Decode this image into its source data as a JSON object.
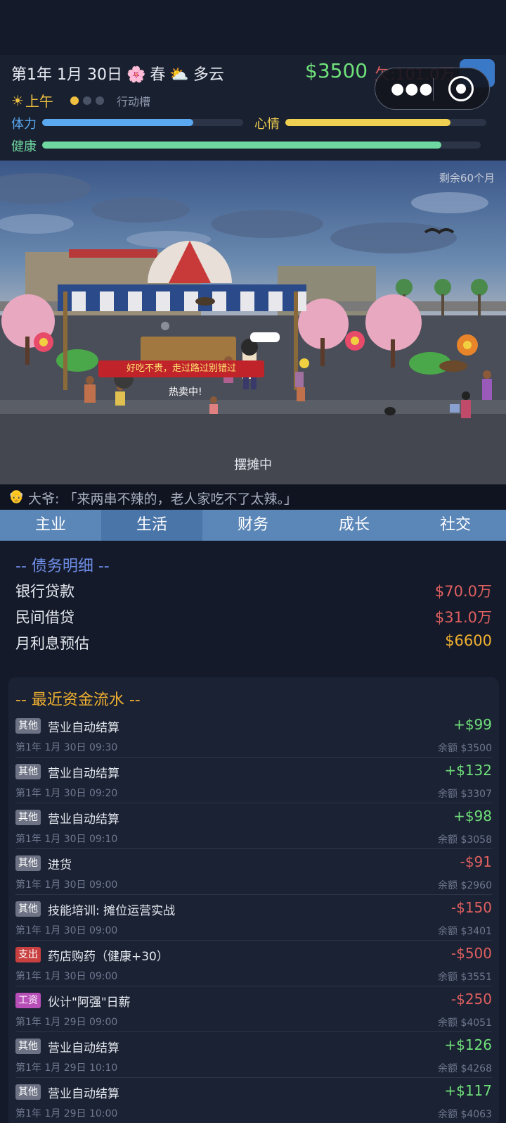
{
  "header": {
    "date": "第1年 1月 30日",
    "season_icon": "🌸",
    "season": "春",
    "weather_icon": "⛅",
    "weather": "多云",
    "money": "$3500",
    "debt": "欠:101.0万",
    "period_icon": "☀",
    "period": "上午",
    "action_label": "行动槽",
    "action_slots": [
      true,
      false,
      false
    ],
    "bars": {
      "stamina": {
        "label": "体力",
        "value": 0.75,
        "color": "#5aa8f0"
      },
      "mood": {
        "label": "心情",
        "value": 0.82,
        "color": "#f0d050"
      },
      "health": {
        "label": "健康",
        "value": 0.91,
        "color": "#6fd7a0"
      }
    }
  },
  "capsule": {
    "more_icon": "more-dots-icon",
    "close_icon": "target-close-icon"
  },
  "scene": {
    "remaining": "剩余60个月",
    "shout": "好吃不贵，走过路过别错过",
    "hot": "热卖中!",
    "status": "摆摊中"
  },
  "message": {
    "icon": "👴",
    "text": "大爷: 「来两串不辣的，老人家吃不了太辣。」"
  },
  "tabs": [
    {
      "label": "主业",
      "active": false
    },
    {
      "label": "生活",
      "active": true
    },
    {
      "label": "财务",
      "active": false
    },
    {
      "label": "成长",
      "active": false
    },
    {
      "label": "社交",
      "active": false
    }
  ],
  "debt_detail": {
    "title": "-- 债务明细 --",
    "rows": [
      {
        "label": "银行贷款",
        "value": "$70.0万",
        "color": "#e06060"
      },
      {
        "label": "民间借贷",
        "value": "$31.0万",
        "color": "#e06060"
      },
      {
        "label": "月利息预估",
        "value": "$6600",
        "color": "#f0b030"
      }
    ]
  },
  "cash_flow": {
    "title": "-- 最近资金流水 --",
    "colors": {
      "income": "#6fe07a",
      "expense": "#e06060",
      "tag_other": "#6d7384",
      "tag_expense": "#c84040",
      "tag_salary": "#b84fb8"
    },
    "items": [
      {
        "tag": "其他",
        "tag_color": "#6d7384",
        "name": "营业自动结算",
        "time": "第1年 1月 30日 09:30",
        "amount": "+$99",
        "balance": "余额 $3500"
      },
      {
        "tag": "其他",
        "tag_color": "#6d7384",
        "name": "营业自动结算",
        "time": "第1年 1月 30日 09:20",
        "amount": "+$132",
        "balance": "余额 $3307"
      },
      {
        "tag": "其他",
        "tag_color": "#6d7384",
        "name": "营业自动结算",
        "time": "第1年 1月 30日 09:10",
        "amount": "+$98",
        "balance": "余额 $3058"
      },
      {
        "tag": "其他",
        "tag_color": "#6d7384",
        "name": "进货",
        "time": "第1年 1月 30日 09:00",
        "amount": "-$91",
        "balance": "余额 $2960"
      },
      {
        "tag": "其他",
        "tag_color": "#6d7384",
        "name": "技能培训: 摊位运营实战",
        "time": "第1年 1月 30日 09:00",
        "amount": "-$150",
        "balance": "余额 $3401"
      },
      {
        "tag": "支出",
        "tag_color": "#c84040",
        "name": "药店购药（健康+30）",
        "time": "第1年 1月 30日 09:00",
        "amount": "-$500",
        "balance": "余额 $3551"
      },
      {
        "tag": "工资",
        "tag_color": "#b84fb8",
        "name": "伙计\"阿强\"日薪",
        "time": "第1年 1月 29日 09:00",
        "amount": "-$250",
        "balance": "余额 $4051"
      },
      {
        "tag": "其他",
        "tag_color": "#6d7384",
        "name": "营业自动结算",
        "time": "第1年 1月 29日 10:10",
        "amount": "+$126",
        "balance": "余额 $4268"
      },
      {
        "tag": "其他",
        "tag_color": "#6d7384",
        "name": "营业自动结算",
        "time": "第1年 1月 29日 10:00",
        "amount": "+$117",
        "balance": "余额 $4063"
      }
    ]
  }
}
